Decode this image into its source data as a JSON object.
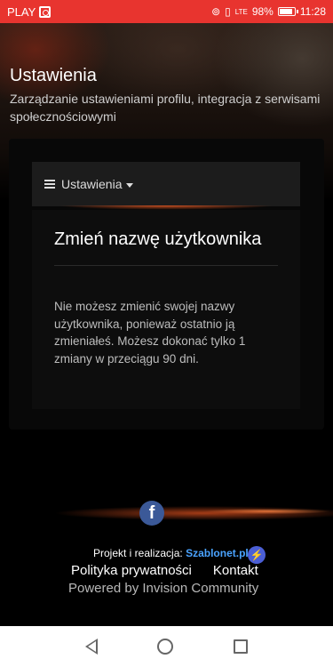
{
  "status_bar": {
    "carrier": "PLAY",
    "battery": "98%",
    "time": "11:28",
    "network": "LTE"
  },
  "header": {
    "title": "Ustawienia",
    "subtitle": "Zarządzanie ustawieniami profilu, integracja z serwisami społecznościowymi"
  },
  "menu": {
    "label": "Ustawienia"
  },
  "content": {
    "title": "Zmień nazwę użytkownika",
    "message": "Nie możesz zmienić swojej nazwy użytkownika, ponieważ ostatnio ją zmieniałeś. Możesz dokonać tylko 1 zmiany w przeciągu 90 dni."
  },
  "footer": {
    "facebook_letter": "f",
    "credit_prefix": "Projekt i realizacja:",
    "credit_brand": "Szablonet.pl",
    "privacy_link": "Polityka prywatności",
    "contact_link": "Kontakt",
    "powered_by": "Powered by Invision Community"
  },
  "colors": {
    "status_bar": "#e8342f",
    "accent_glow": "#eb5a23",
    "facebook": "#3b5998",
    "brand_link": "#4aa3ff"
  }
}
